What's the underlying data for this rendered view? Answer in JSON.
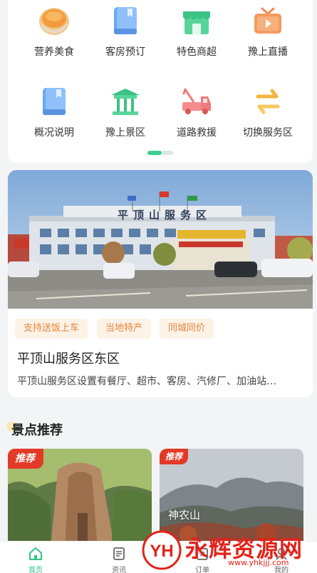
{
  "grid": {
    "items": [
      {
        "label": "营养美食",
        "icon": "food-bowl-icon"
      },
      {
        "label": "客房预订",
        "icon": "room-booking-icon"
      },
      {
        "label": "特色商超",
        "icon": "store-icon"
      },
      {
        "label": "豫上直播",
        "icon": "tv-live-icon"
      },
      {
        "label": "概况说明",
        "icon": "info-book-icon"
      },
      {
        "label": "豫上景区",
        "icon": "pavilion-icon"
      },
      {
        "label": "道路救援",
        "icon": "tow-truck-icon"
      },
      {
        "label": "切换服务区",
        "icon": "switch-arrows-icon"
      }
    ],
    "page_indicator": {
      "current": 1,
      "total": 2
    }
  },
  "service_area": {
    "photo_sign": "平顶山服务区",
    "tags": [
      "支持送饭上车",
      "当地特产",
      "同城同价"
    ],
    "title": "平顶山服务区东区",
    "description": "平顶山服务区设置有餐厅、超市、客房、汽修厂、加油站…"
  },
  "scenic_section": {
    "title": "景点推荐",
    "cards": [
      {
        "badge": "推荐",
        "name": ""
      },
      {
        "badge": "推荐",
        "name": "神农山"
      }
    ]
  },
  "tabbar": {
    "tabs": [
      {
        "label": "首页",
        "active": true
      },
      {
        "label": "资讯",
        "active": false
      },
      {
        "label": "订单",
        "active": false
      },
      {
        "label": "我的",
        "active": false
      }
    ]
  },
  "watermark": {
    "text": "永辉资源网",
    "url": "www.yhkjjj.com",
    "logo": "YH"
  },
  "colors": {
    "accent": "#3ccf8e",
    "tag_text": "#e5853a",
    "tag_bg": "#fdf2e6",
    "badge": "#e23a26"
  }
}
